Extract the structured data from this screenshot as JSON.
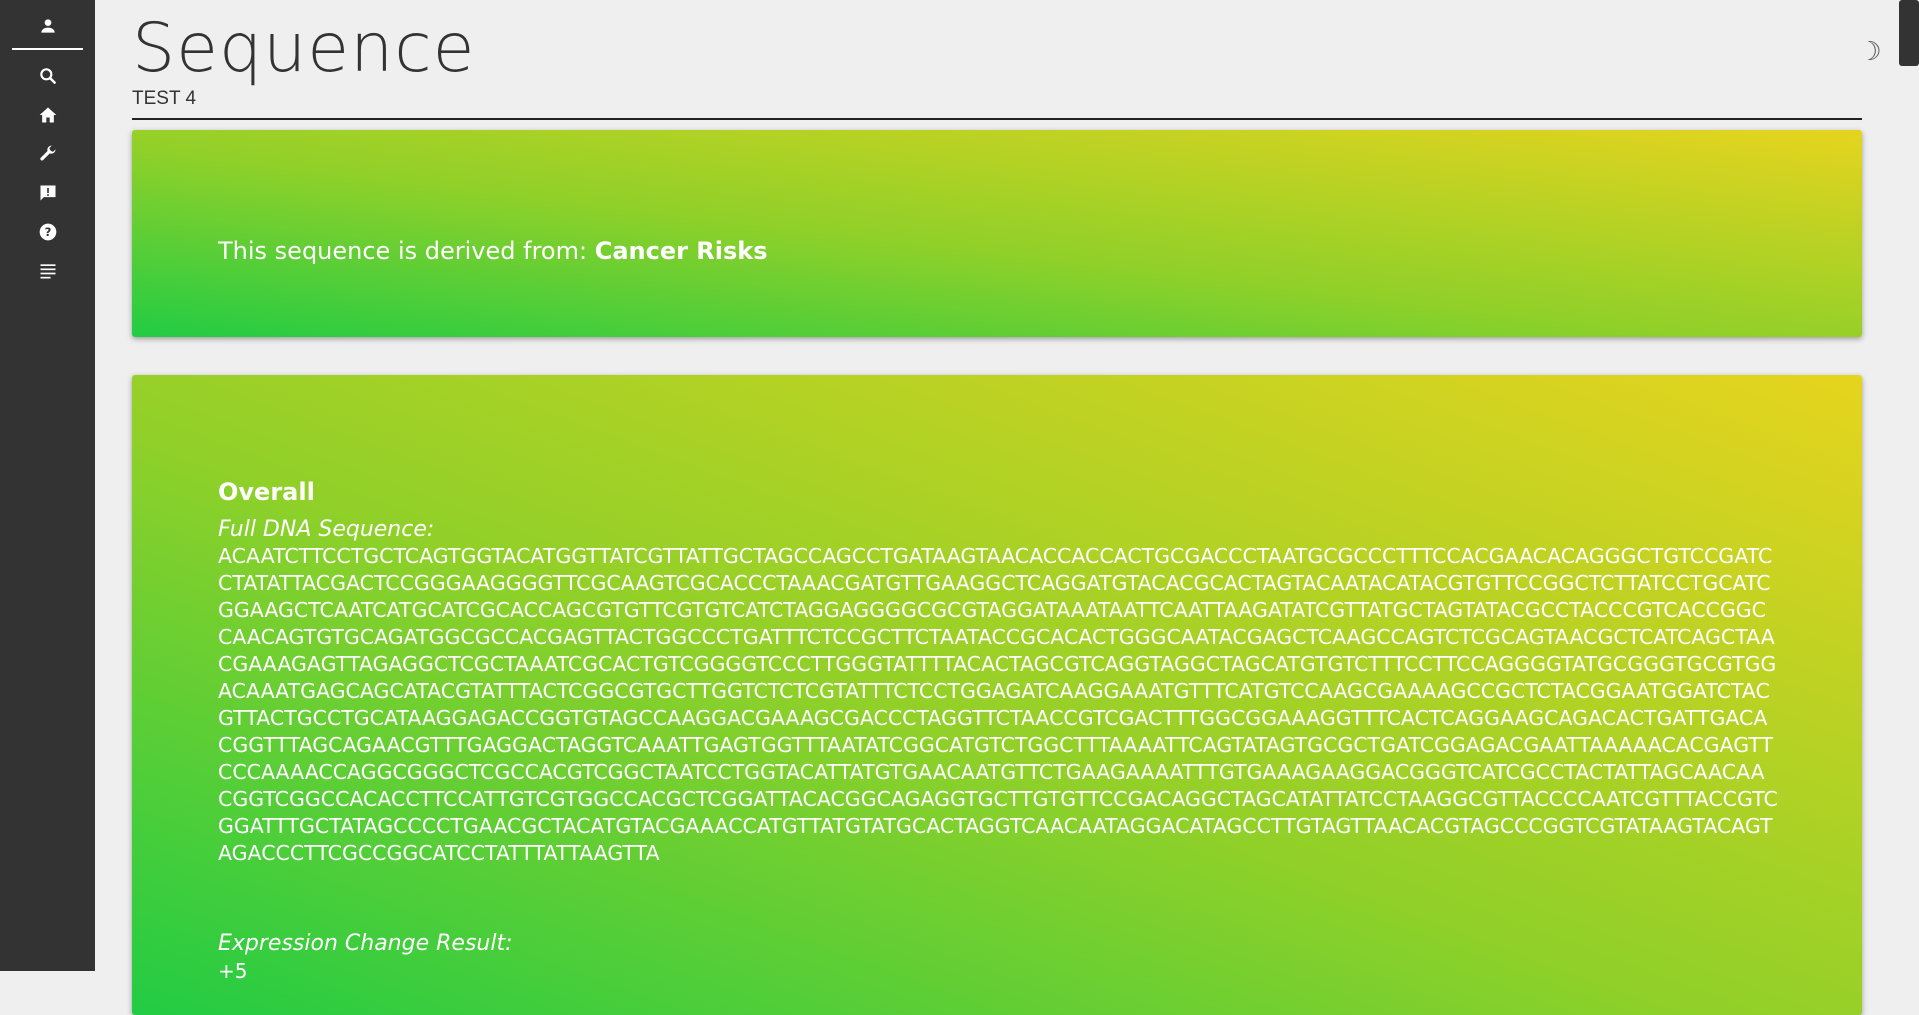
{
  "sidebar": {
    "items": [
      {
        "icon": "person-icon",
        "label": "account"
      },
      {
        "icon": "search-icon",
        "label": "search"
      },
      {
        "icon": "home-icon",
        "label": "home"
      },
      {
        "icon": "wrench-icon",
        "label": "tools"
      },
      {
        "icon": "feedback-icon",
        "label": "feedback"
      },
      {
        "icon": "help-icon",
        "label": "help"
      },
      {
        "icon": "notes-icon",
        "label": "notes"
      }
    ]
  },
  "header": {
    "title": "Sequence",
    "subtitle": "TEST 4",
    "theme_toggle": "☽"
  },
  "derived_card": {
    "prefix": "This sequence is derived from:",
    "source": "Cancer Risks"
  },
  "overall_card": {
    "heading": "Overall",
    "dna_label": "Full DNA Sequence:",
    "dna_sequence": "ACAATCTTCCTGCTCAGTGGTACATGGTTATCGTTATTGCTAGCCAGCCTGATAAGTAACACCACCACTGCGACCCTAATGCGCCCTTTCCACGAACACAGGGCTGTCCGATCCTATATTACGACTCCGGGAAGGGGTTCGCAAGTCGCACCCTAAACGATGTTGAAGGCTCAGGATGTACACGCACTAGTACAATACATACGTGTTCCGGCTCTTATCCTGCATCGGAAGCTCAATCATGCATCGCACCAGCGTGTTCGTGTCATCTAGGAGGGGCGCGTAGGATAAATAATTCAATTAAGATATCGTTATGCTAGTATACGCCTACCCGTCACCGGCCAACAGTGTGCAGATGGCGCCACGAGTTACTGGCCCTGATTTCTCCGCTTCTAATACCGCACACTGGGCAATACGAGCTCAAGCCAGTCTCGCAGTAACGCTCATCAGCTAACGAAAGAGTTAGAGGCTCGCTAAATCGCACTGTCGGGGTCCCTTGGGTATTTTACACTAGCGTCAGGTAGGCTAGCATGTGTCTTTCCTTCCAGGGGTATGCGGGTGCGTGGACAAATGAGCAGCATACGTATTTACTCGGCGTGCTTGGTCTCTCGTATTTCTCCTGGAGATCAAGGAAATGTTTCATGTCCAAGCGAAAAGCCGCTCTACGGAATGGATCTACGTTACTGCCTGCATAAGGAGACCGGTGTAGCCAAGGACGAAAGCGACCCTAGGTTCTAACCGTCGACTTTGGCGGAAAGGTTTCACTCAGGAAGCAGACACTGATTGACACGGTTTAGCAGAACGTTTGAGGACTAGGTCAAATTGAGTGGTTTAATATCGGCATGTCTGGCTTTAAAATTCAGTATAGTGCGCTGATCGGAGACGAATTAAAAACACGAGTTCCCAAAACCAGGCGGGCTCGCCACGTCGGCTAATCCTGGTACATTATGTGAACAATGTTCTGAAGAAAATTTGTGAAAGAAGGACGGGTCATCGCCTACTATTAGCAACAACGGTCGGCCACACCTTCCATTGTCGTGGCCACGCTCGGATTACACGGCAGAGGTGCTTGTGTTCCGACAGGCTAGCATATTATCCTAAGGCGTTACCCCAATCGTTTACCGTCGGATTTGCTATAGCCCCTGAACGCTACATGTACGAAACCATGTTATGTATGCACTAGGTCAACAATAGGACATAGCCTTGTAGTTAACACGTAGCCCGGTCGTATAAGTACAGTAGACCCTTCGCCGGCATCCTATTTATTAAGTTA",
    "expression_label": "Expression Change Result:",
    "expression_value": "+5"
  },
  "colors": {
    "sidebar": "#333333",
    "background": "#efefef",
    "gradient_start": "#22cc44",
    "gradient_end": "#e6d41e"
  }
}
